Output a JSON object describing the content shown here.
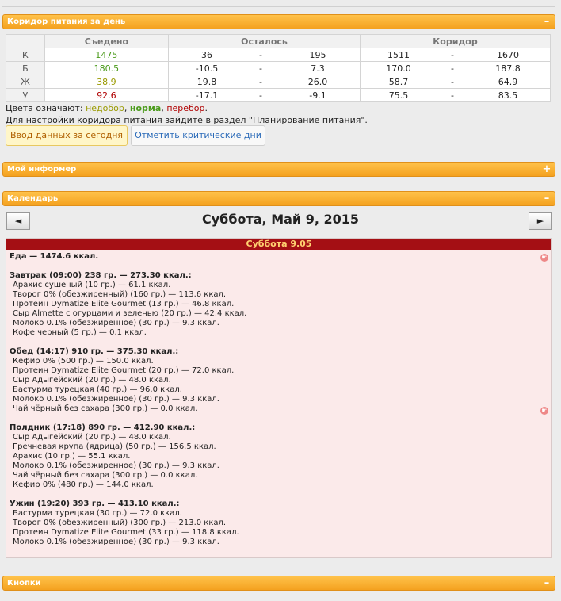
{
  "corridor": {
    "header": "Коридор питания за день",
    "toggle": "–",
    "col_eaten": "Съедено",
    "col_left": "Осталось",
    "col_corridor": "Коридор",
    "rows": [
      {
        "label": "К",
        "eaten": "1475",
        "eaten_status": "ok",
        "left_min": "36",
        "left_max": "195",
        "cor_min": "1511",
        "cor_max": "1670"
      },
      {
        "label": "Б",
        "eaten": "180.5",
        "eaten_status": "ok",
        "left_min": "-10.5",
        "left_max": "7.3",
        "cor_min": "170.0",
        "cor_max": "187.8"
      },
      {
        "label": "Ж",
        "eaten": "38.9",
        "eaten_status": "under",
        "left_min": "19.8",
        "left_max": "26.0",
        "cor_min": "58.7",
        "cor_max": "64.9"
      },
      {
        "label": "У",
        "eaten": "92.6",
        "eaten_status": "over",
        "left_min": "-17.1",
        "left_max": "-9.1",
        "cor_min": "75.5",
        "cor_max": "83.5"
      }
    ],
    "dash": "-",
    "legend_prefix": "Цвета означают:",
    "legend_under": "недобор",
    "legend_ok": "норма",
    "legend_over": "перебор",
    "legend_sep1": ",",
    "legend_sep2": ",",
    "legend_end": ".",
    "hint": "Для настройки коридора питания зайдите в раздел \"Планирование питания\".",
    "btn_input": "Ввод данных за сегодня",
    "btn_critical": "Отметить критические дни"
  },
  "informer": {
    "header": "Мой информер",
    "toggle": "+"
  },
  "calendar": {
    "header": "Календарь",
    "toggle": "–",
    "prev": "◄",
    "next": "►",
    "title": "Суббота, Май 9, 2015",
    "day_header": "Суббота 9.05",
    "total": "Еда — 1474.6 ккал.",
    "meals": [
      {
        "title": "Завтрак (09:00) 238 гр. — 273.30 ккал.:",
        "items": [
          "Арахис сушеный (10 гр.) — 61.1 ккал.",
          "Творог 0% (обезжиренный) (160 гр.) — 113.6 ккал.",
          "Протеин Dymatize Elite Gourmet (13 гр.) — 46.8 ккал.",
          "Сыр Almette с огурцами и зеленью (20 гр.) — 42.4 ккал.",
          "Молоко 0.1% (обезжиренное) (30 гр.) — 9.3 ккал.",
          "Кофе черный (5 гр.) — 0.1 ккал."
        ]
      },
      {
        "title": "Обед (14:17) 910 гр. — 375.30 ккал.:",
        "items": [
          "Кефир 0% (500 гр.) — 150.0 ккал.",
          "Протеин Dymatize Elite Gourmet (20 гр.) — 72.0 ккал.",
          "Сыр Адыгейский (20 гр.) — 48.0 ккал.",
          "Бастурма турецкая (40 гр.) — 96.0 ккал.",
          "Молоко 0.1% (обезжиренное) (30 гр.) — 9.3 ккал.",
          "Чай чёрный без сахара (300 гр.) — 0.0 ккал."
        ]
      },
      {
        "title": "Полдник (17:18) 890 гр. — 412.90 ккал.:",
        "items": [
          "Сыр Адыгейский (20 гр.) — 48.0 ккал.",
          "Гречневая крупа (ядрица) (50 гр.) — 156.5 ккал.",
          "Арахис (10 гр.) — 55.1 ккал.",
          "Молоко 0.1% (обезжиренное) (30 гр.) — 9.3 ккал.",
          "Чай чёрный без сахара (300 гр.) — 0.0 ккал.",
          "Кефир 0% (480 гр.) — 144.0 ккал."
        ]
      },
      {
        "title": "Ужин (19:20) 393 гр. — 413.10 ккал.:",
        "items": [
          "Бастурма турецкая (30 гр.) — 72.0 ккал.",
          "Творог 0% (обезжиренный) (300 гр.) — 213.0 ккал.",
          "Протеин Dymatize Elite Gourmet (33 гр.) — 118.8 ккал.",
          "Молоко 0.1% (обезжиренное) (30 гр.) — 9.3 ккал."
        ]
      }
    ]
  },
  "buttons_panel": {
    "header": "Кнопки",
    "toggle": "–"
  },
  "colors": {
    "accent": "#f4a11f",
    "ok": "#4a9a1a",
    "under": "#9a9a00",
    "over": "#b00000",
    "day_header": "#a40f14"
  }
}
